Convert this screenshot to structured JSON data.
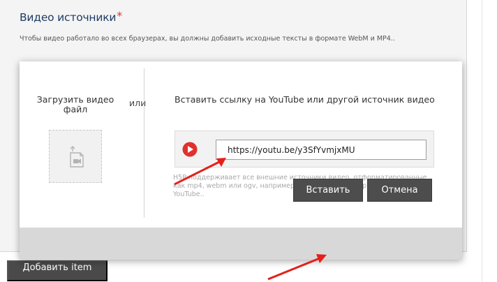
{
  "section": {
    "title": "Видео источники",
    "required_mark": "*",
    "description": "Чтобы видео работало во всех браузерах, вы должны добавить исходные тексты в формате WebM и MP4.."
  },
  "add_item_button": "Добавить item",
  "modal": {
    "upload_label": "Загрузить видео файл",
    "or_label": "или",
    "embed_label": "Вставить ссылку на YouTube или другой источник видео",
    "url_value": "https://youtu.be/y3SfYvmjxMU",
    "help_text": "H5P поддерживает все внешние источники видео, отформатированные как mp4, webm или ogv, например Vimeo Pro, и поддерживает ссылки на YouTube..",
    "insert_button": "Вставить",
    "cancel_button": "Отмена"
  },
  "colors": {
    "accent_red": "#e0312d",
    "title_blue": "#1f3c63",
    "button_dark": "#4d4d4d"
  },
  "icons": {
    "upload": "video-upload-icon",
    "play": "youtube-play-icon",
    "annotation": "red-arrow"
  }
}
